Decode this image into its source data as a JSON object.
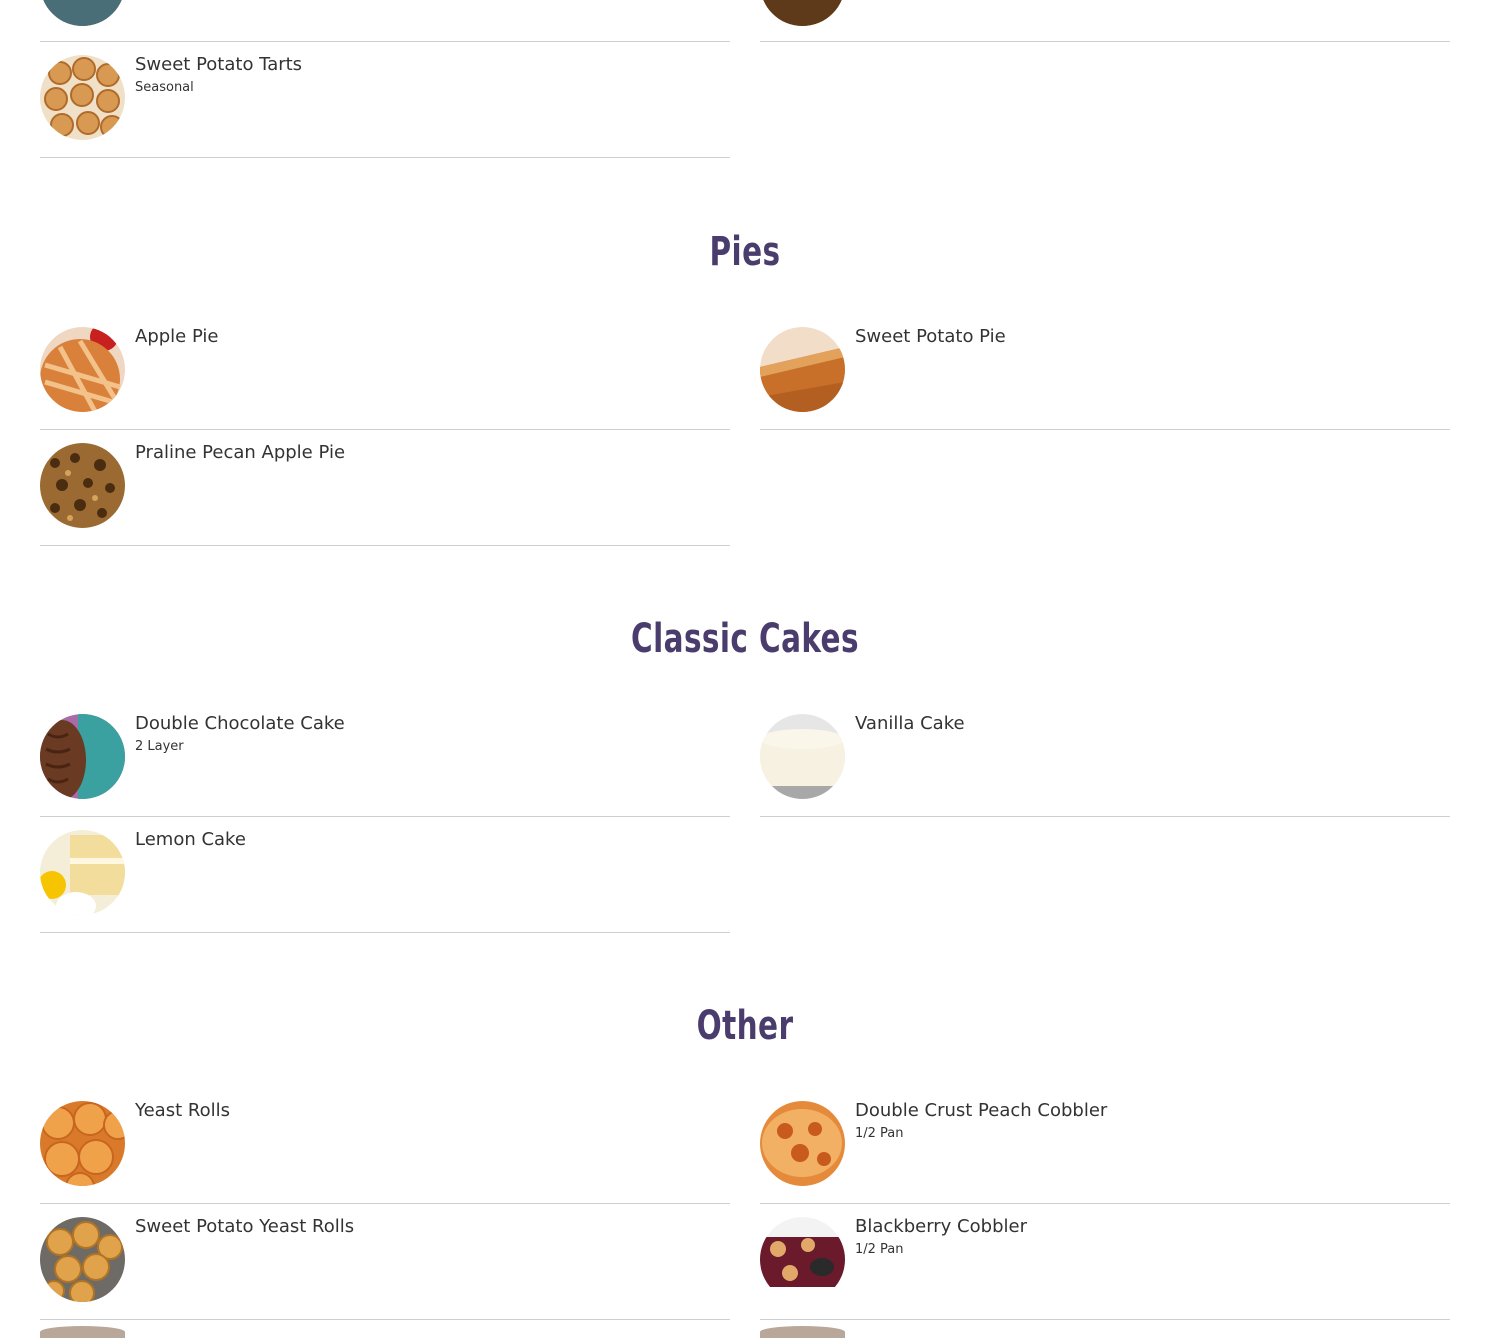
{
  "colors": {
    "heading": "#4a3d6e",
    "text": "#333333",
    "divider": "#cfcfcf"
  },
  "top_fragment": [
    {
      "thumb_icon": "chocolate-bar-photo-icon"
    },
    {
      "thumb_icon": "pecan-bar-photo-icon"
    }
  ],
  "sections": [
    {
      "heading": "",
      "items": [
        {
          "name": "Sweet Potato Tarts",
          "note": "Seasonal",
          "thumb_icon": "sweet-potato-tarts-photo-icon"
        }
      ]
    },
    {
      "heading": "Pies",
      "items": [
        {
          "name": "Apple Pie",
          "note": "",
          "thumb_icon": "apple-pie-photo-icon"
        },
        {
          "name": "Sweet Potato Pie",
          "note": "",
          "thumb_icon": "sweet-potato-pie-photo-icon"
        },
        {
          "name": "Praline Pecan Apple Pie",
          "note": "",
          "thumb_icon": "praline-pecan-apple-pie-photo-icon"
        }
      ]
    },
    {
      "heading": "Classic Cakes",
      "items": [
        {
          "name": "Double Chocolate Cake",
          "note": "2 Layer",
          "thumb_icon": "double-chocolate-cake-photo-icon"
        },
        {
          "name": "Vanilla Cake",
          "note": "",
          "thumb_icon": "vanilla-cake-photo-icon"
        },
        {
          "name": "Lemon Cake",
          "note": "",
          "thumb_icon": "lemon-cake-photo-icon"
        }
      ]
    },
    {
      "heading": "Other",
      "items": [
        {
          "name": "Yeast Rolls",
          "note": "",
          "thumb_icon": "yeast-rolls-photo-icon"
        },
        {
          "name": "Double Crust Peach Cobbler",
          "note": "1/2 Pan",
          "thumb_icon": "peach-cobbler-photo-icon"
        },
        {
          "name": "Sweet Potato Yeast Rolls",
          "note": "",
          "thumb_icon": "sweet-potato-yeast-rolls-photo-icon"
        },
        {
          "name": "Blackberry Cobbler",
          "note": "1/2 Pan",
          "thumb_icon": "blackberry-cobbler-photo-icon"
        }
      ]
    }
  ]
}
